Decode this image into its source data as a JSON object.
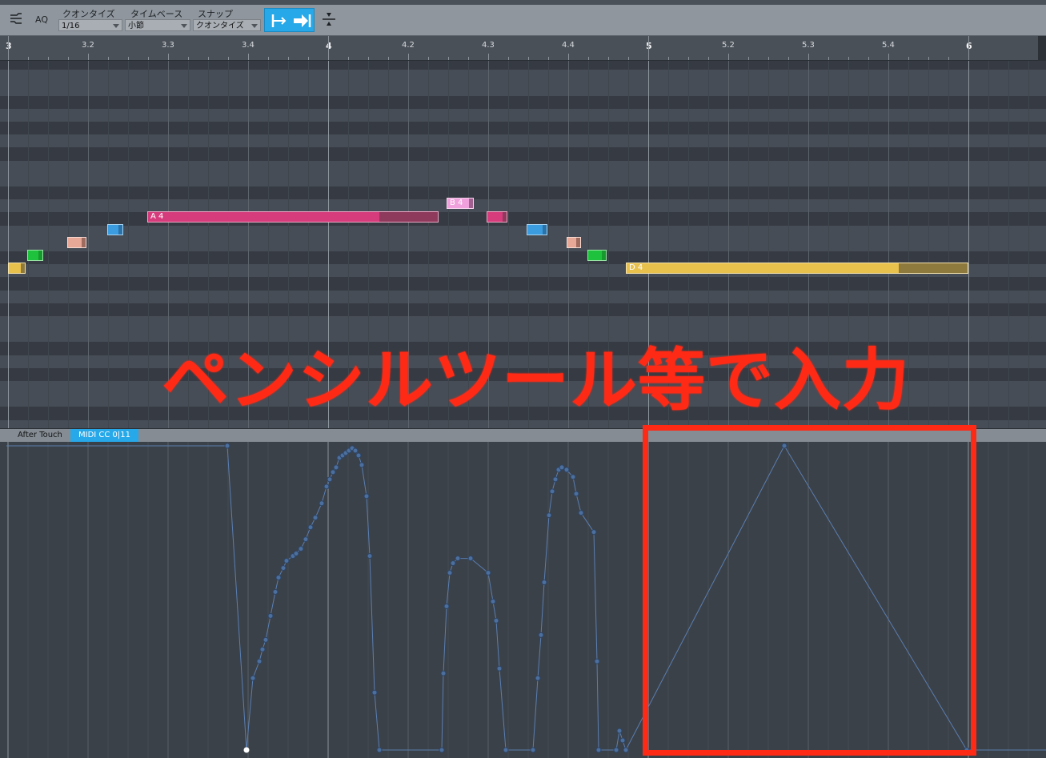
{
  "toolbar": {
    "aq_label": "AQ",
    "quantize": {
      "label": "クオンタイズ",
      "value": "1/16"
    },
    "timebase": {
      "label": "タイムベース",
      "value": "小節"
    },
    "snap": {
      "label": "スナップ",
      "value": "クオンタイズ"
    },
    "icons": [
      "wave-tool-icon",
      "snap-start-icon",
      "snap-arrow-icon",
      "split-icon"
    ]
  },
  "ruler": {
    "labels": [
      "3",
      "3.2",
      "3.3",
      "3.4",
      "4",
      "4.2",
      "4.3",
      "4.4",
      "5",
      "5.2",
      "5.3",
      "5.4",
      "6"
    ],
    "major": [
      "3",
      "4",
      "5",
      "6"
    ]
  },
  "notes": [
    {
      "label": "",
      "color": "#e8c04c",
      "tail": "#8f7a3e",
      "pitch_row": 9,
      "start": 3.0,
      "end": 3.055
    },
    {
      "label": "",
      "color": "#1fc23c",
      "tail": "#169a2e",
      "pitch_row": 8,
      "start": 3.06,
      "end": 3.11
    },
    {
      "label": "",
      "color": "#e8a898",
      "tail": "#9e6b5e",
      "pitch_row": 7,
      "start": 3.185,
      "end": 3.245
    },
    {
      "label": "",
      "color": "#3c9ce0",
      "tail": "#2a72a8",
      "pitch_row": 6,
      "start": 3.31,
      "end": 3.36
    },
    {
      "label": "A 4",
      "color": "#d63c7c",
      "tail": "#8e3a5c",
      "pitch_row": 5,
      "start": 3.435,
      "end": 4.345
    },
    {
      "label": "B 4",
      "color": "#f0a0dc",
      "tail": "#a06090",
      "pitch_row": 4,
      "start": 4.37,
      "end": 4.455
    },
    {
      "label": "",
      "color": "#d63c7c",
      "tail": "#8e3a5c",
      "pitch_row": 5,
      "start": 4.495,
      "end": 4.56
    },
    {
      "label": "",
      "color": "#3c9ce0",
      "tail": "#2a72a8",
      "pitch_row": 6,
      "start": 4.62,
      "end": 4.685
    },
    {
      "label": "",
      "color": "#e8a898",
      "tail": "#9e6b5e",
      "pitch_row": 7,
      "start": 4.745,
      "end": 4.79
    },
    {
      "label": "",
      "color": "#1fc23c",
      "tail": "#169a2e",
      "pitch_row": 8,
      "start": 4.81,
      "end": 4.87
    },
    {
      "label": "D 4",
      "color": "#e8c04c",
      "tail": "#8f7a3e",
      "pitch_row": 9,
      "start": 4.93,
      "end": 6.0
    }
  ],
  "cc_tabs": [
    {
      "label": "After Touch",
      "active": false
    },
    {
      "label": "MIDI CC 0|11",
      "active": true
    }
  ],
  "cc_points": [
    [
      2.995,
      127
    ],
    [
      3.685,
      127
    ],
    [
      3.745,
      0
    ],
    [
      3.765,
      30
    ],
    [
      3.785,
      37
    ],
    [
      3.795,
      42
    ],
    [
      3.805,
      46
    ],
    [
      3.82,
      56
    ],
    [
      3.835,
      66
    ],
    [
      3.845,
      72
    ],
    [
      3.86,
      76
    ],
    [
      3.87,
      79
    ],
    [
      3.89,
      81
    ],
    [
      3.9,
      82
    ],
    [
      3.915,
      84
    ],
    [
      3.93,
      88
    ],
    [
      3.945,
      93
    ],
    [
      3.96,
      97
    ],
    [
      3.98,
      103
    ],
    [
      3.995,
      110
    ],
    [
      4.005,
      113
    ],
    [
      4.015,
      116
    ],
    [
      4.025,
      118
    ],
    [
      4.035,
      122
    ],
    [
      4.045,
      123
    ],
    [
      4.055,
      124
    ],
    [
      4.065,
      125
    ],
    [
      4.075,
      126
    ],
    [
      4.085,
      125
    ],
    [
      4.095,
      123
    ],
    [
      4.105,
      119
    ],
    [
      4.12,
      106
    ],
    [
      4.13,
      81
    ],
    [
      4.145,
      24
    ],
    [
      4.16,
      0
    ],
    [
      4.355,
      0
    ],
    [
      4.36,
      32
    ],
    [
      4.37,
      60
    ],
    [
      4.38,
      74
    ],
    [
      4.39,
      78
    ],
    [
      4.405,
      80
    ],
    [
      4.445,
      80
    ],
    [
      4.5,
      74
    ],
    [
      4.515,
      62
    ],
    [
      4.525,
      54
    ],
    [
      4.535,
      34
    ],
    [
      4.555,
      0
    ],
    [
      4.64,
      0
    ],
    [
      4.655,
      30
    ],
    [
      4.665,
      48
    ],
    [
      4.675,
      70
    ],
    [
      4.69,
      98
    ],
    [
      4.7,
      108
    ],
    [
      4.71,
      113
    ],
    [
      4.72,
      117
    ],
    [
      4.73,
      118
    ],
    [
      4.745,
      117
    ],
    [
      4.765,
      114
    ],
    [
      4.775,
      107
    ],
    [
      4.79,
      99
    ],
    [
      4.83,
      91
    ],
    [
      4.84,
      37
    ],
    [
      4.845,
      0
    ],
    [
      4.9,
      0
    ],
    [
      4.91,
      8
    ],
    [
      4.92,
      4
    ],
    [
      4.93,
      0
    ],
    [
      5.425,
      127
    ],
    [
      5.995,
      0
    ],
    [
      6.25,
      0
    ]
  ],
  "overlay_text": "ペンシルツール等で入力",
  "highlight_color": "#ff2a16"
}
